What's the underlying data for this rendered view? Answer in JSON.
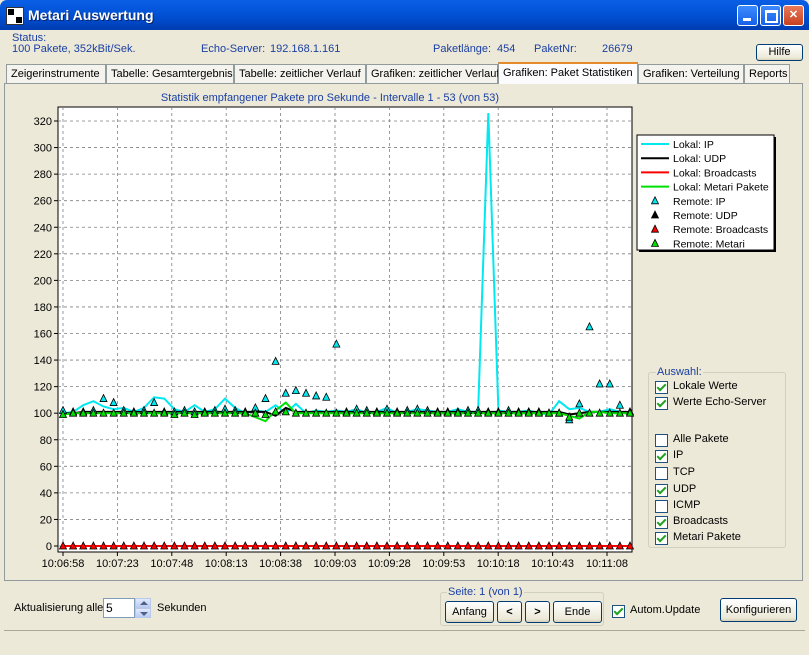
{
  "window": {
    "title": "Metari Auswertung",
    "help_label": "Hilfe"
  },
  "status": {
    "label": "Status:",
    "summary": "100 Pakete, 352kBit/Sek.",
    "echo_label": "Echo-Server:",
    "echo_value": "192.168.1.161",
    "paketlaenge_label": "Paketlänge:",
    "paketlaenge_value": "454",
    "paketnr_label": "PaketNr:",
    "paketnr_value": "26679"
  },
  "tabs": [
    {
      "label": "Zeigerinstrumente"
    },
    {
      "label": "Tabelle: Gesamtergebnis"
    },
    {
      "label": "Tabelle: zeitlicher Verlauf"
    },
    {
      "label": "Grafiken: zeitlicher Verlauf"
    },
    {
      "label": "Grafiken: Paket Statistiken",
      "active": true
    },
    {
      "label": "Grafiken: Verteilung"
    },
    {
      "label": "Reports"
    }
  ],
  "chart_data": {
    "type": "line",
    "title": "Statistik empfangener Pakete pro Sekunde - Intervalle 1 - 53 (von 53)",
    "ylim": [
      0,
      330
    ],
    "yticks": [
      0,
      20,
      40,
      60,
      80,
      100,
      120,
      140,
      160,
      180,
      200,
      220,
      240,
      260,
      280,
      300,
      320
    ],
    "xticks": [
      "10:06:58",
      "10:07:23",
      "10:07:48",
      "10:08:13",
      "10:08:38",
      "10:09:03",
      "10:09:28",
      "10:09:53",
      "10:10:18",
      "10:10:43",
      "10:11:08"
    ],
    "grid": true,
    "legend_position": "right",
    "colors": {
      "ip": "#00e8f0",
      "udp": "#000000",
      "broadcasts": "#ff0000",
      "metari": "#00e000"
    },
    "series": [
      {
        "name": "Lokal: IP",
        "kind": "line",
        "color": "#00e8f0",
        "values": [
          100,
          101,
          106,
          109,
          105,
          103,
          104,
          101,
          104,
          112,
          111,
          103,
          101,
          106,
          101,
          103,
          111,
          104,
          100,
          102,
          101,
          106,
          100,
          107,
          100,
          102,
          101,
          102,
          101,
          103,
          100,
          101,
          104,
          100,
          101,
          103,
          102,
          101,
          101,
          103,
          101,
          101,
          326,
          102,
          101,
          101,
          102,
          100,
          99,
          109,
          103,
          104,
          101,
          101,
          103,
          101,
          100
        ]
      },
      {
        "name": "Lokal: UDP",
        "kind": "line",
        "color": "#000000",
        "values": [
          100,
          100,
          101,
          101,
          101,
          101,
          101,
          101,
          101,
          101,
          101,
          101,
          101,
          101,
          101,
          101,
          101,
          101,
          101,
          101,
          101,
          98,
          104,
          101,
          101,
          101,
          101,
          101,
          101,
          101,
          101,
          101,
          101,
          101,
          101,
          101,
          101,
          101,
          101,
          101,
          101,
          101,
          101,
          101,
          101,
          101,
          101,
          101,
          101,
          101,
          99,
          100,
          101,
          101,
          101,
          101,
          101
        ]
      },
      {
        "name": "Lokal: Broadcasts",
        "kind": "line",
        "color": "#ff0000",
        "values": [
          0,
          0,
          0,
          0,
          0,
          0,
          0,
          0,
          0,
          0,
          0,
          0,
          0,
          0,
          0,
          0,
          0,
          0,
          0,
          0,
          0,
          0,
          0,
          0,
          0,
          0,
          0,
          0,
          0,
          0,
          0,
          0,
          0,
          0,
          0,
          0,
          0,
          0,
          0,
          0,
          0,
          0,
          0,
          0,
          0,
          0,
          0,
          0,
          0,
          0,
          0,
          0,
          0,
          0,
          0,
          0,
          0
        ]
      },
      {
        "name": "Lokal: Metari Pakete",
        "kind": "line",
        "color": "#00e000",
        "values": [
          99,
          100,
          100,
          100,
          100,
          100,
          100,
          100,
          100,
          100,
          100,
          100,
          100,
          100,
          100,
          100,
          100,
          100,
          100,
          97,
          94,
          102,
          108,
          100,
          100,
          100,
          100,
          100,
          100,
          100,
          100,
          100,
          100,
          100,
          100,
          100,
          100,
          100,
          100,
          100,
          100,
          100,
          100,
          100,
          100,
          100,
          100,
          100,
          100,
          100,
          98,
          96,
          101,
          101,
          100,
          100,
          100
        ]
      },
      {
        "name": "Remote: IP",
        "kind": "marker",
        "color": "#00e8f0",
        "values": [
          102,
          101,
          101,
          102,
          111,
          108,
          102,
          101,
          102,
          108,
          101,
          101,
          102,
          101,
          101,
          102,
          103,
          102,
          101,
          104,
          111,
          139,
          115,
          117,
          115,
          113,
          112,
          152,
          101,
          103,
          102,
          101,
          103,
          101,
          102,
          103,
          102,
          101,
          101,
          101,
          102,
          102,
          101,
          101,
          102,
          101,
          101,
          101,
          100,
          100,
          95,
          107,
          165,
          122,
          122,
          106,
          101
        ]
      },
      {
        "name": "Remote: UDP",
        "kind": "marker",
        "color": "#000000",
        "values": []
      },
      {
        "name": "Remote: Broadcasts",
        "kind": "marker",
        "color": "#ff0000",
        "values": [
          0,
          0,
          0,
          0,
          0,
          0,
          0,
          0,
          0,
          0,
          0,
          0,
          0,
          0,
          0,
          0,
          0,
          0,
          0,
          0,
          0,
          0,
          0,
          0,
          0,
          0,
          0,
          0,
          0,
          0,
          0,
          0,
          0,
          0,
          0,
          0,
          0,
          0,
          0,
          0,
          0,
          0,
          0,
          0,
          0,
          0,
          0,
          0,
          0,
          0,
          0,
          0,
          0,
          0,
          0,
          0,
          0
        ]
      },
      {
        "name": "Remote: Metari",
        "kind": "marker",
        "color": "#00e000",
        "values": [
          99,
          100,
          100,
          100,
          100,
          100,
          100,
          100,
          100,
          100,
          100,
          99,
          100,
          99,
          100,
          100,
          100,
          100,
          100,
          100,
          99,
          101,
          101,
          100,
          100,
          100,
          100,
          100,
          100,
          100,
          100,
          100,
          100,
          100,
          100,
          100,
          100,
          100,
          100,
          100,
          100,
          100,
          100,
          100,
          100,
          100,
          100,
          100,
          100,
          100,
          97,
          100,
          100,
          100,
          100,
          100,
          100
        ]
      }
    ]
  },
  "auswahl": {
    "title": "Auswahl:",
    "items": [
      {
        "label": "Lokale Werte",
        "checked": true
      },
      {
        "label": "Werte Echo-Server",
        "checked": true
      },
      {
        "label": "Alle Pakete",
        "checked": false
      },
      {
        "label": "IP",
        "checked": true
      },
      {
        "label": "TCP",
        "checked": false
      },
      {
        "label": "UDP",
        "checked": true
      },
      {
        "label": "ICMP",
        "checked": false
      },
      {
        "label": "Broadcasts",
        "checked": true
      },
      {
        "label": "Metari Pakete",
        "checked": true
      }
    ]
  },
  "footer": {
    "update_label": "Aktualisierung alle",
    "update_value": "5",
    "seconds_label": "Sekunden",
    "seite_label": "Seite: 1 (von 1)",
    "anfang_label": "Anfang",
    "prev_label": "<",
    "next_label": ">",
    "ende_label": "Ende",
    "autom_label": "Autom.Update",
    "autom_checked": true,
    "konfig_label": "Konfigurieren"
  }
}
